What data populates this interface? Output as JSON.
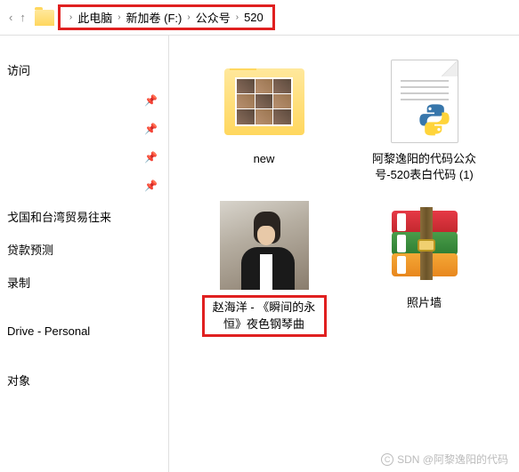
{
  "breadcrumb": {
    "items": [
      "此电脑",
      "新加卷 (F:)",
      "公众号",
      "520"
    ]
  },
  "sidebar": {
    "items": [
      {
        "label": "访问",
        "pinned": false
      },
      {
        "label": "",
        "pinned": true
      },
      {
        "label": "",
        "pinned": true
      },
      {
        "label": "",
        "pinned": true
      },
      {
        "label": "",
        "pinned": true
      },
      {
        "label": "戈国和台湾贸易往来",
        "pinned": false
      },
      {
        "label": "贷款预测",
        "pinned": false
      },
      {
        "label": "录制",
        "pinned": false
      },
      {
        "label": "",
        "pinned": false
      },
      {
        "label": "Drive - Personal",
        "pinned": false
      },
      {
        "label": "",
        "pinned": false
      },
      {
        "label": "对象",
        "pinned": false
      }
    ]
  },
  "files": {
    "folder_new": "new",
    "python_file": "阿黎逸阳的代码公众号-520表白代码 (1)",
    "music_file": "赵海洋 - 《瞬间的永恒》夜色钢琴曲",
    "rar_file": "照片墙"
  },
  "watermark": {
    "prefix": "C",
    "text": "SDN @阿黎逸阳的代码"
  }
}
